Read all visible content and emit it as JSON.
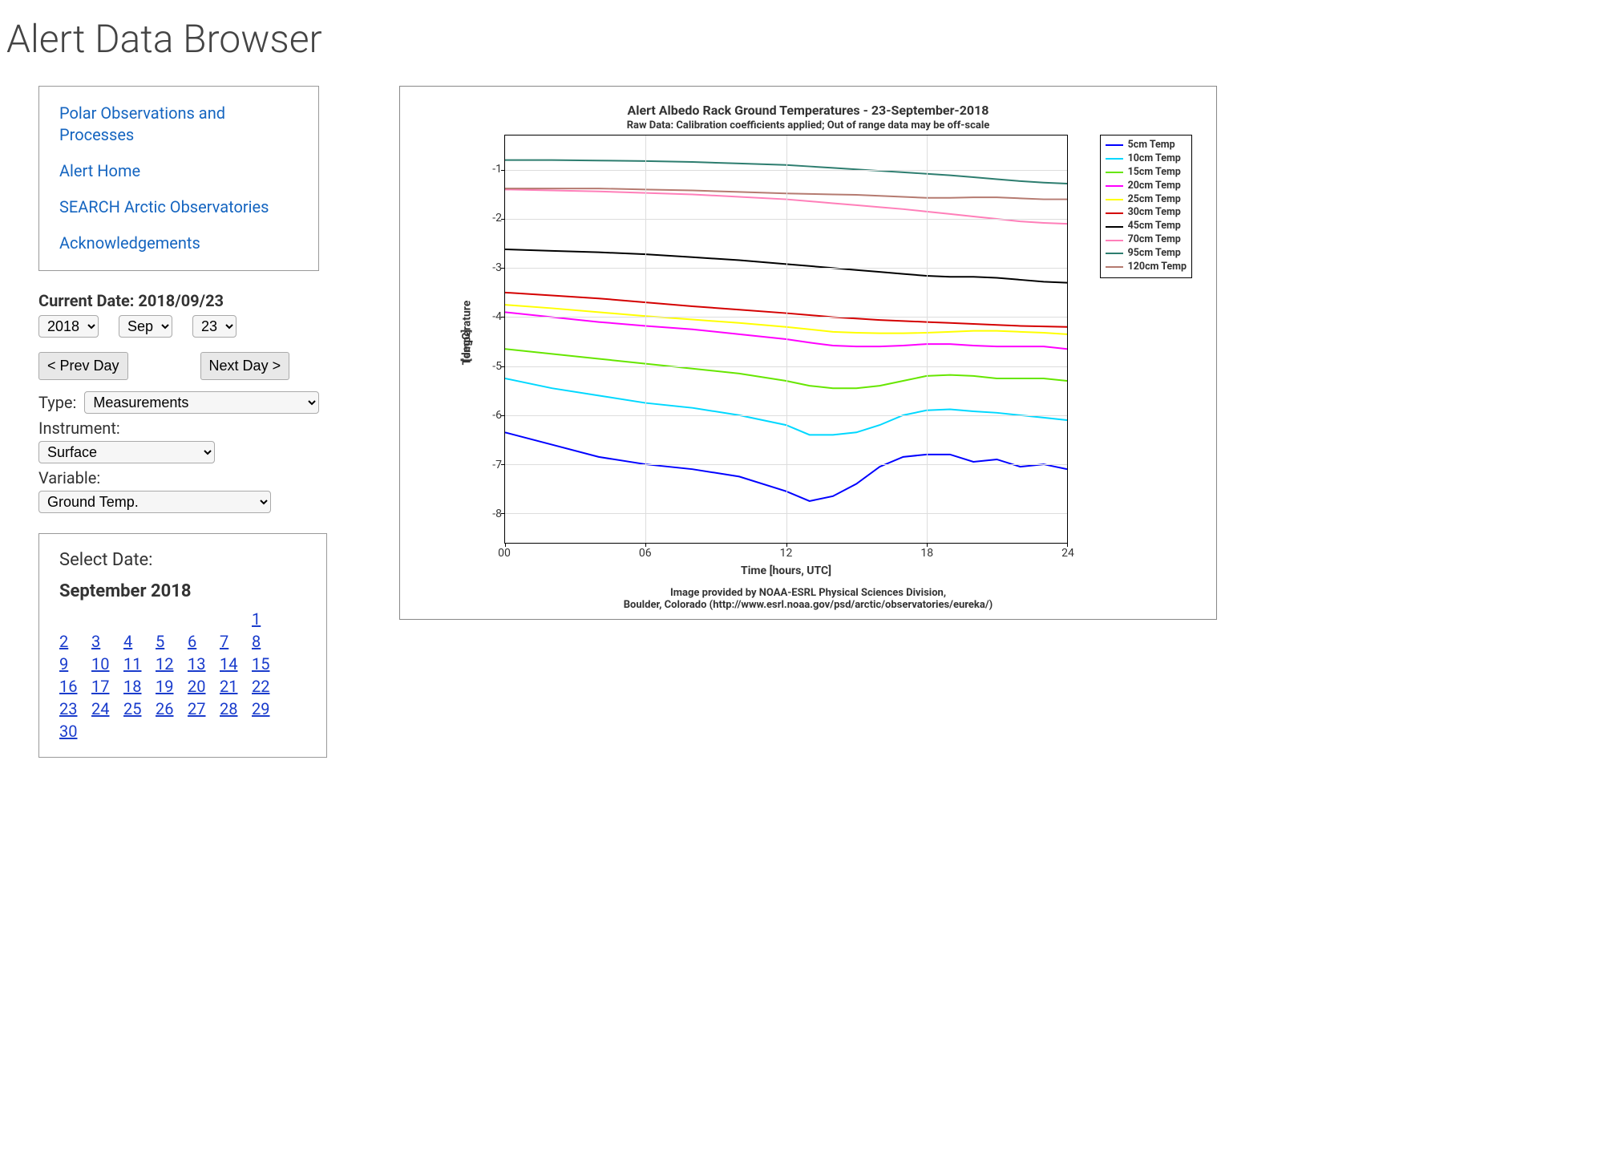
{
  "page_title": "Alert Data Browser",
  "nav_links": [
    "Polar Observations and Processes",
    "Alert Home",
    "SEARCH Arctic Observatories",
    "Acknowledgements"
  ],
  "controls": {
    "current_date_label": "Current Date:  2018/09/23",
    "year_value": "2018",
    "month_value": "Sep",
    "day_value": "23",
    "prev_day_label": "< Prev Day",
    "next_day_label": "Next Day >",
    "type_label": "Type:",
    "type_value": "Measurements",
    "instrument_label": "Instrument:",
    "instrument_value": "Surface",
    "variable_label": "Variable:",
    "variable_value": "Ground Temp."
  },
  "calendar": {
    "select_date_label": "Select Date:",
    "month_label": "September 2018",
    "first_weekday": 6,
    "days_in_month": 30
  },
  "chart_credits": [
    "Image provided by NOAA-ESRL Physical Sciences Division,",
    "Boulder, Colorado (http://www.esrl.noaa.gov/psd/arctic/observatories/eureka/)"
  ],
  "chart_data": {
    "type": "line",
    "title": "Alert Albedo Rack Ground Temperatures - 23-September-2018",
    "subtitle": "Raw Data: Calibration coefficients applied; Out of range data may be off-scale",
    "xlabel": "Time [hours, UTC]",
    "ylabel": "Temperature",
    "ylabel2": "[degC]",
    "xlim": [
      0,
      24
    ],
    "ylim": [
      -8.6,
      -0.3
    ],
    "x_ticks": [
      0,
      6,
      12,
      18,
      24
    ],
    "x_tick_labels": [
      "00",
      "06",
      "12",
      "18",
      "24"
    ],
    "y_ticks": [
      -8,
      -7,
      -6,
      -5,
      -4,
      -3,
      -2,
      -1
    ],
    "x": [
      0,
      2,
      4,
      6,
      8,
      10,
      12,
      13,
      14,
      15,
      16,
      17,
      18,
      19,
      20,
      21,
      22,
      23,
      24
    ],
    "series": [
      {
        "name": "5cm Temp",
        "color": "#0000ff",
        "values": [
          -6.35,
          -6.6,
          -6.85,
          -7.0,
          -7.1,
          -7.25,
          -7.55,
          -7.75,
          -7.65,
          -7.4,
          -7.05,
          -6.85,
          -6.8,
          -6.8,
          -6.95,
          -6.9,
          -7.05,
          -7.0,
          -7.1
        ]
      },
      {
        "name": "10cm Temp",
        "color": "#00d8ff",
        "values": [
          -5.25,
          -5.45,
          -5.6,
          -5.75,
          -5.85,
          -6.0,
          -6.2,
          -6.4,
          -6.4,
          -6.35,
          -6.2,
          -6.0,
          -5.9,
          -5.88,
          -5.92,
          -5.95,
          -6.0,
          -6.05,
          -6.1
        ]
      },
      {
        "name": "15cm Temp",
        "color": "#66e600",
        "values": [
          -4.65,
          -4.75,
          -4.85,
          -4.95,
          -5.05,
          -5.15,
          -5.3,
          -5.4,
          -5.45,
          -5.45,
          -5.4,
          -5.3,
          -5.2,
          -5.18,
          -5.2,
          -5.25,
          -5.25,
          -5.25,
          -5.3
        ]
      },
      {
        "name": "20cm Temp",
        "color": "#ff00ff",
        "values": [
          -3.9,
          -4.0,
          -4.1,
          -4.18,
          -4.25,
          -4.35,
          -4.45,
          -4.52,
          -4.58,
          -4.6,
          -4.6,
          -4.58,
          -4.55,
          -4.55,
          -4.58,
          -4.6,
          -4.6,
          -4.6,
          -4.65
        ]
      },
      {
        "name": "25cm Temp",
        "color": "#ffff00",
        "values": [
          -3.75,
          -3.82,
          -3.9,
          -3.98,
          -4.05,
          -4.12,
          -4.2,
          -4.25,
          -4.3,
          -4.32,
          -4.33,
          -4.33,
          -4.32,
          -4.3,
          -4.28,
          -4.28,
          -4.3,
          -4.32,
          -4.35
        ]
      },
      {
        "name": "30cm Temp",
        "color": "#d40000",
        "values": [
          -3.5,
          -3.56,
          -3.62,
          -3.7,
          -3.78,
          -3.85,
          -3.92,
          -3.96,
          -4.0,
          -4.03,
          -4.06,
          -4.08,
          -4.1,
          -4.12,
          -4.14,
          -4.16,
          -4.18,
          -4.19,
          -4.2
        ]
      },
      {
        "name": "45cm Temp",
        "color": "#000000",
        "values": [
          -2.62,
          -2.65,
          -2.68,
          -2.72,
          -2.78,
          -2.84,
          -2.92,
          -2.96,
          -3.0,
          -3.04,
          -3.08,
          -3.12,
          -3.16,
          -3.18,
          -3.18,
          -3.2,
          -3.24,
          -3.28,
          -3.3
        ]
      },
      {
        "name": "70cm Temp",
        "color": "#ff7fb9",
        "values": [
          -1.4,
          -1.42,
          -1.44,
          -1.47,
          -1.5,
          -1.55,
          -1.6,
          -1.64,
          -1.68,
          -1.72,
          -1.76,
          -1.8,
          -1.85,
          -1.9,
          -1.95,
          -2.0,
          -2.05,
          -2.08,
          -2.1
        ]
      },
      {
        "name": "95cm Temp",
        "color": "#2d7d6f",
        "values": [
          -0.8,
          -0.8,
          -0.81,
          -0.82,
          -0.84,
          -0.87,
          -0.9,
          -0.93,
          -0.96,
          -0.99,
          -1.02,
          -1.05,
          -1.08,
          -1.11,
          -1.15,
          -1.19,
          -1.23,
          -1.26,
          -1.28
        ]
      },
      {
        "name": "120cm Temp",
        "color": "#b57a70",
        "values": [
          -1.38,
          -1.38,
          -1.38,
          -1.4,
          -1.42,
          -1.45,
          -1.48,
          -1.49,
          -1.5,
          -1.51,
          -1.53,
          -1.55,
          -1.57,
          -1.57,
          -1.56,
          -1.56,
          -1.58,
          -1.6,
          -1.6
        ]
      }
    ]
  }
}
